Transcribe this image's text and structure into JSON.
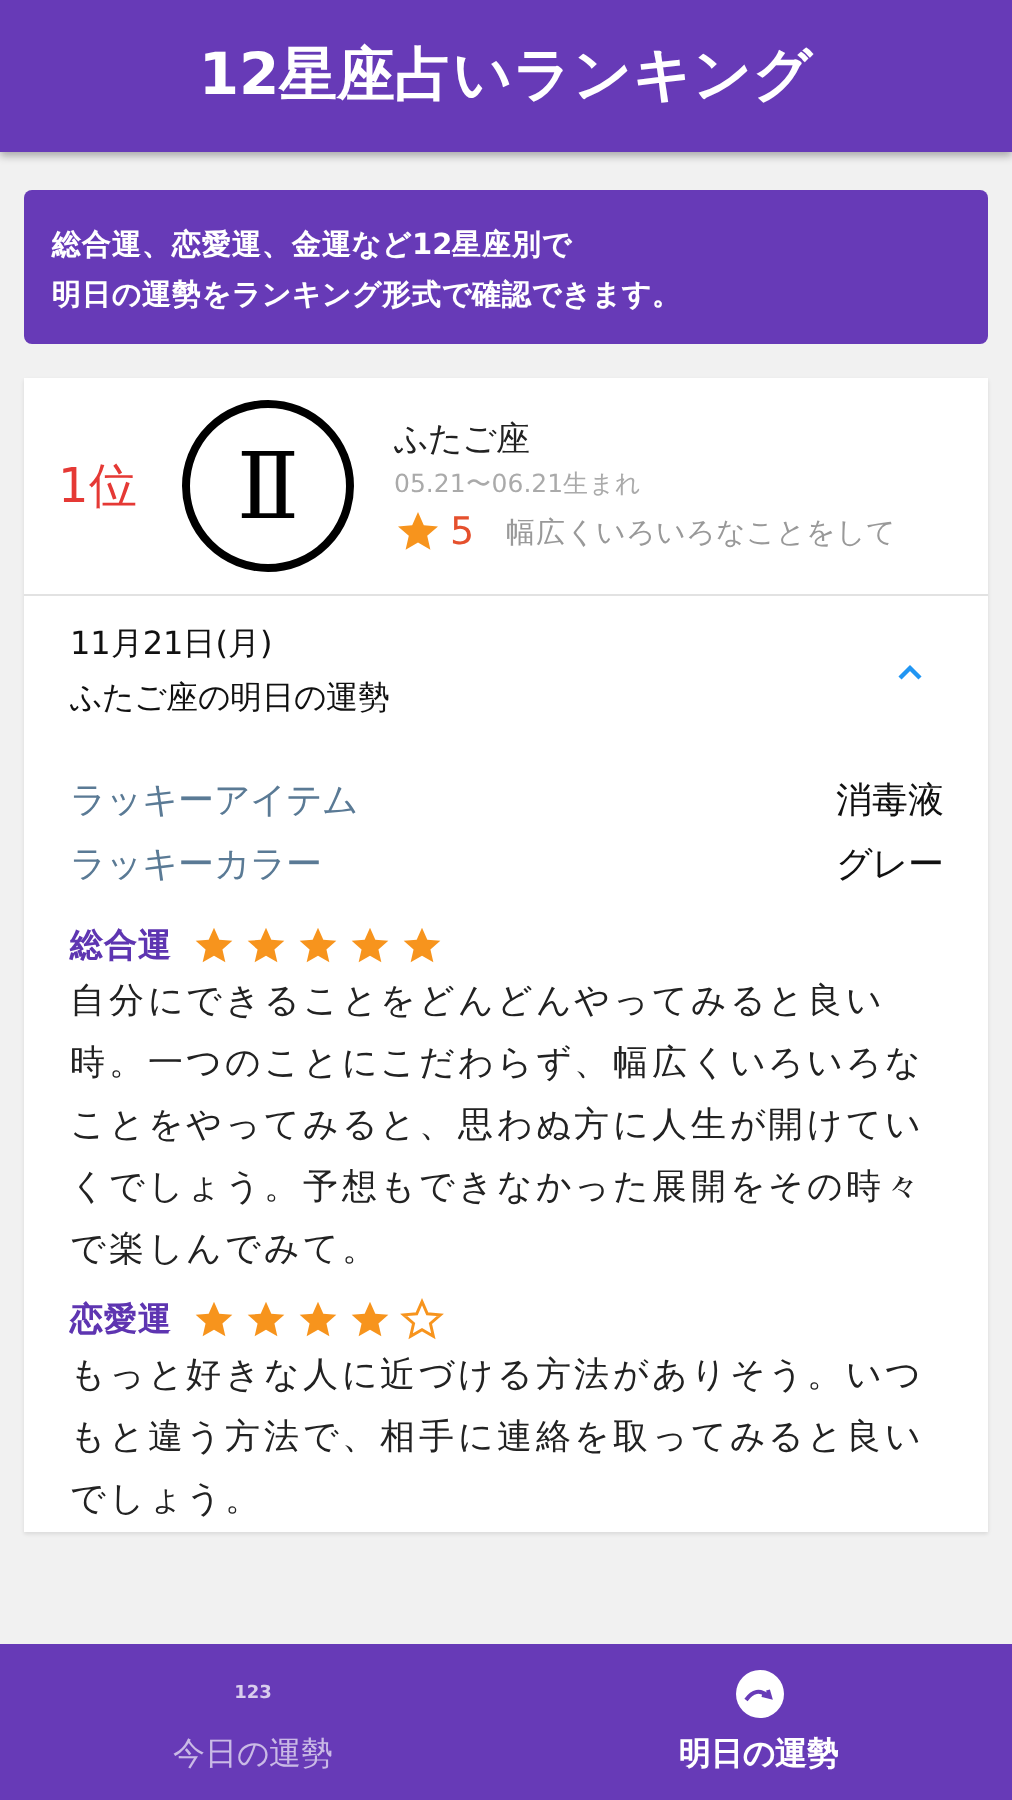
{
  "app_bar": {
    "title": "12星座占いランキング"
  },
  "banner": {
    "lines": [
      "総合運、恋愛運、金運など12星座別で",
      "明日の運勢をランキング形式で確認できます。"
    ]
  },
  "ranking": {
    "rank": "1位",
    "symbol": "Ⅱ",
    "sign": "ふたご座",
    "dates": "05.21〜06.21生まれ",
    "score": "5",
    "summary": "幅広くいろいろなことをして",
    "detail": {
      "expanded": true,
      "date": "11月21日(月)",
      "heading": "ふたご座の明日の運勢",
      "lucky": [
        {
          "label": "ラッキーアイテム",
          "value": "消毒液"
        },
        {
          "label": "ラッキーカラー",
          "value": "グレー"
        }
      ],
      "fortunes": [
        {
          "title": "総合運",
          "stars": 5,
          "text": "自分にできることをどんどんやってみると良い時。一つのことにこだわらず、幅広くいろいろなことをやってみると、思わぬ方に人生が開けていくでしょう。予想もできなかった展開をその時々で楽しんでみて。"
        },
        {
          "title": "恋愛運",
          "stars": 4,
          "text": "もっと好きな人に近づける方法がありそう。いつもと違う方法で、相手に連絡を取ってみると良いでしょう。"
        }
      ]
    }
  },
  "bottom_nav": [
    {
      "icon_text": "123",
      "label": "今日の運勢",
      "selected": false
    },
    {
      "label": "明日の運勢",
      "selected": true
    }
  ]
}
